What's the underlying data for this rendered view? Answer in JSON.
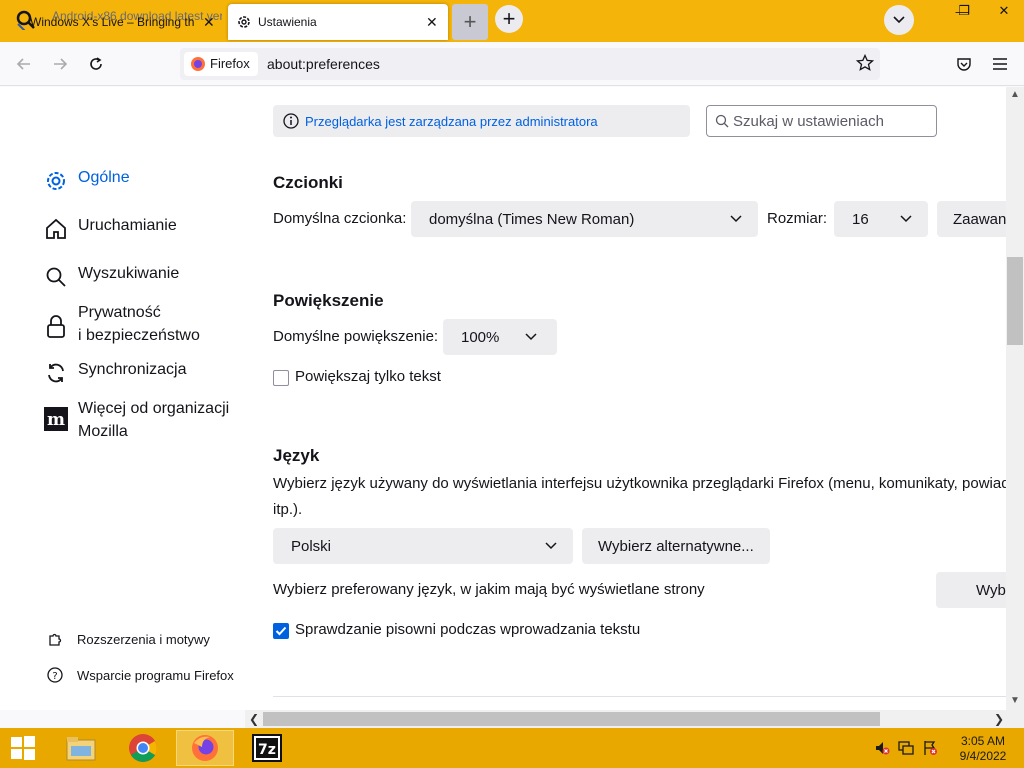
{
  "browser": {
    "tabs": [
      {
        "title": "Windows X's Live – Bringing th",
        "ghost_title": "Android-x86 download latest ver",
        "active": false
      },
      {
        "title": "Ustawienia",
        "active": true
      }
    ],
    "identity_label": "Firefox",
    "url": "about:preferences"
  },
  "sidebar": {
    "items": [
      {
        "label": "Ogólne",
        "icon": "gear-icon",
        "active": true
      },
      {
        "label": "Uruchamianie",
        "icon": "home-icon"
      },
      {
        "label": "Wyszukiwanie",
        "icon": "search-icon"
      },
      {
        "label_line1": "Prywatność",
        "label_line2": "i bezpieczeństwo",
        "icon": "lock-icon"
      },
      {
        "label": "Synchronizacja",
        "icon": "sync-icon"
      },
      {
        "label_line1": "Więcej od organizacji",
        "label_line2": "Mozilla",
        "icon": "mozilla-icon"
      }
    ],
    "footer": [
      {
        "label": "Rozszerzenia i motywy",
        "icon": "puzzle-icon"
      },
      {
        "label": "Wsparcie programu Firefox",
        "icon": "help-icon"
      }
    ]
  },
  "policy_notice": "Przeglądarka jest zarządzana przez administratora",
  "search": {
    "placeholder": "Szukaj w ustawieniach",
    "value": ""
  },
  "fonts": {
    "heading": "Czcionki",
    "default_font_label": "Domyślna czcionka:",
    "default_font_value": "domyślna (Times New Roman)",
    "size_label": "Rozmiar:",
    "size_value": "16",
    "advanced_button": "Zaawansowane..."
  },
  "zoom": {
    "heading": "Powiększenie",
    "default_zoom_label": "Domyślne powiększenie:",
    "default_zoom_value": "100%",
    "text_only_label": "Powiększaj tylko tekst",
    "text_only_checked": false
  },
  "language": {
    "heading": "Język",
    "description_line1": "Wybierz język używany do wyświetlania interfejsu użytkownika przeglądarki Firefox (menu, komunikaty, powiadomienia",
    "description_line2": "itp.).",
    "ui_language_value": "Polski",
    "alternatives_button": "Wybierz alternatywne...",
    "page_language_label": "Wybierz preferowany język, w jakim mają być wyświetlane strony",
    "page_language_button": "Wybierz...",
    "spellcheck_label": "Sprawdzanie pisowni podczas wprowadzania tekstu",
    "spellcheck_checked": true
  },
  "taskbar": {
    "time": "3:05 AM",
    "date": "9/4/2022"
  },
  "colors": {
    "accent": "#0061e0",
    "titlebar": "#f5b40a",
    "taskbar": "#e8a800"
  }
}
